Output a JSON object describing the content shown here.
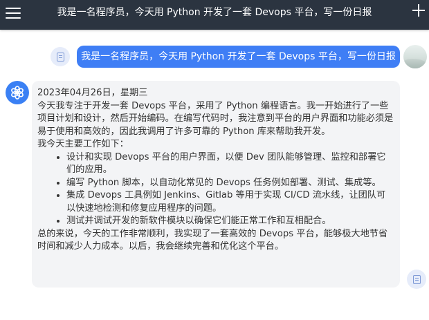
{
  "header": {
    "title": "我是一名程序员，今天用 Python 开发了一套 Devops 平台，写一份日报",
    "menu_icon": "hamburger-menu-icon",
    "new_chat_icon": "plus-icon"
  },
  "user_message": {
    "text": "我是一名程序员，今天用 Python 开发了一套 Devops 平台，写一份日报"
  },
  "bot_message": {
    "date_line": "2023年04月26日，星期三",
    "intro": "今天我专注于开发一套 Devops 平台，采用了 Python 编程语言。我一开始进行了一些项目计划和设计，然后开始编码。在编写代码时，我注意到平台的用户界面和功能必须是易于使用和高效的，因此我调用了许多可靠的 Python 库来帮助我开发。",
    "work_heading": "我今天主要工作如下：",
    "tasks": [
      "设计和实现 Devops 平台的用户界面，以便 Dev 团队能够管理、监控和部署它们的应用。",
      "编写 Python 脚本，以自动化常见的 Devops 任务例如部署、测试、集成等。",
      "集成 Devops 工具例如 Jenkins、Gitlab 等用于实现 CI/CD 流水线，让团队可以快速地检测和修复应用程序的问题。",
      "测试并调试开发的新软件模块以确保它们能正常工作和互相配合。"
    ],
    "summary": "总的来说，今天的工作非常顺利，我实现了一套高效的 Devops 平台，能够极大地节省时间和减少人力成本。以后，我会继续完善和优化这个平台。"
  },
  "icons": {
    "copy": "copy-icon",
    "bot_avatar": "openai-logo-icon"
  },
  "colors": {
    "header_bg": "#2b3440",
    "user_bubble": "#3f7ef5",
    "bot_bubble": "#f3f4f6",
    "bot_avatar": "#3a80f4",
    "copy_button": "#e6ecfa"
  }
}
